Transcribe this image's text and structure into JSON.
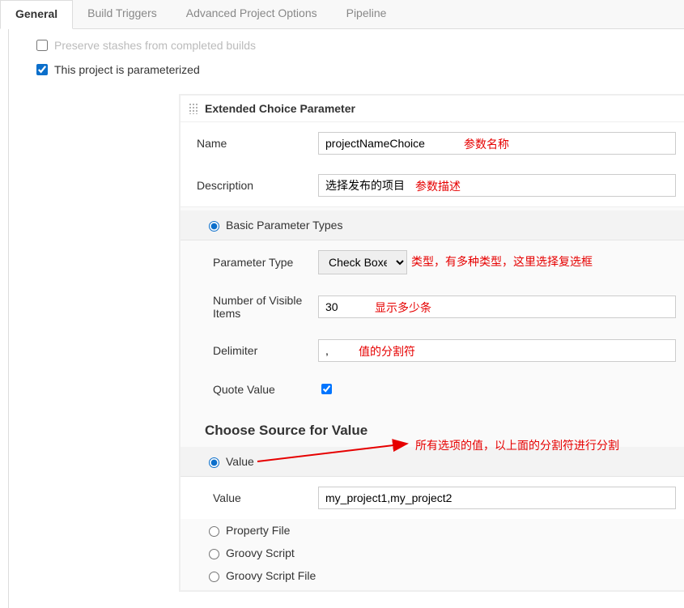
{
  "tabs": {
    "general": "General",
    "buildTriggers": "Build Triggers",
    "advanced": "Advanced Project Options",
    "pipeline": "Pipeline"
  },
  "checkboxes": {
    "preserveStashes": "Preserve stashes from completed builds",
    "parameterized": "This project is parameterized"
  },
  "paramHeader": "Extended Choice Parameter",
  "labels": {
    "name": "Name",
    "description": "Description",
    "basicTypes": "Basic Parameter Types",
    "parameterType": "Parameter Type",
    "numVisible": "Number of Visible Items",
    "delimiter": "Delimiter",
    "quoteValue": "Quote Value",
    "chooseSource": "Choose Source for Value",
    "valueRadio": "Value",
    "valueLabel": "Value",
    "propertyFile": "Property File",
    "groovyScript": "Groovy Script",
    "groovyScriptFile": "Groovy Script File"
  },
  "values": {
    "name": "projectNameChoice",
    "description": "选择发布的项目",
    "parameterType": "Check Boxes",
    "numVisible": "30",
    "delimiter": ",",
    "value": "my_project1,my_project2"
  },
  "annotations": {
    "name": "参数名称",
    "description": "参数描述",
    "type": "类型，有多种类型，这里选择复选框",
    "numVisible": "显示多少条",
    "delimiter": "值的分割符",
    "allValues": "所有选项的值，以上面的分割符进行分割"
  }
}
